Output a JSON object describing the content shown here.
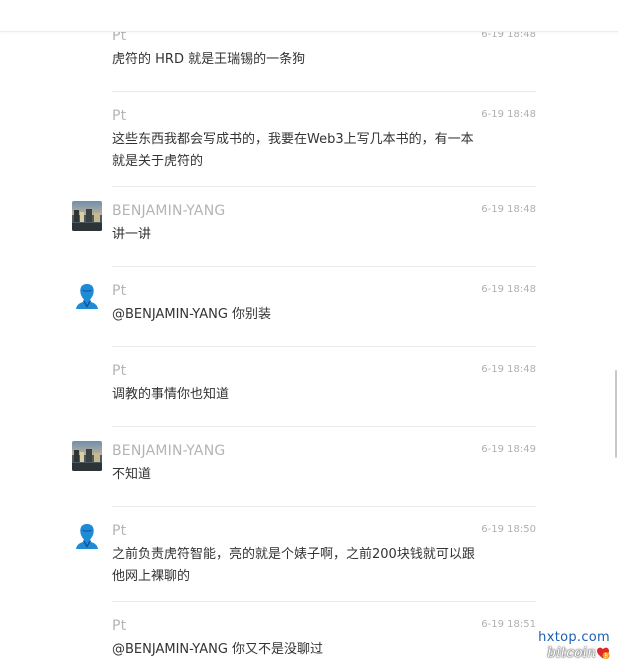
{
  "messages": [
    {
      "author": "Pt",
      "time": "6-19 18:48",
      "lines": [
        "虎符的 HRD 就是王瑞锡的一条狗"
      ],
      "avatar": "none"
    },
    {
      "author": "Pt",
      "time": "6-19 18:48",
      "lines": [
        "这些东西我都会写成书的，我要在Web3上写几本书的，有一本",
        "就是关于虎符的"
      ],
      "avatar": "none"
    },
    {
      "author": "BENJAMIN-YANG",
      "time": "6-19 18:48",
      "lines": [
        "讲一讲"
      ],
      "avatar": "photo"
    },
    {
      "author": "Pt",
      "time": "6-19 18:48",
      "lines": [
        "@BENJAMIN-YANG 你别装"
      ],
      "avatar": "blue-person"
    },
    {
      "author": "Pt",
      "time": "6-19 18:48",
      "lines": [
        "调教的事情你也知道"
      ],
      "avatar": "none"
    },
    {
      "author": "BENJAMIN-YANG",
      "time": "6-19 18:49",
      "lines": [
        "不知道"
      ],
      "avatar": "photo"
    },
    {
      "author": "Pt",
      "time": "6-19 18:50",
      "lines": [
        "之前负责虎符智能，亮的就是个婊子啊，之前200块钱就可以跟",
        "他网上裸聊的"
      ],
      "avatar": "blue-person"
    },
    {
      "author": "Pt",
      "time": "6-19 18:51",
      "lines": [
        "@BENJAMIN-YANG 你又不是没聊过"
      ],
      "avatar": "none"
    }
  ],
  "watermark": {
    "site": "hxtop.com",
    "brand": "bitcoin"
  },
  "colors": {
    "author": "#b4b4b4",
    "text": "#333333",
    "time": "#b0b0b0",
    "separator": "#eaeaea",
    "avatar_blue": "#1f8ad6"
  }
}
